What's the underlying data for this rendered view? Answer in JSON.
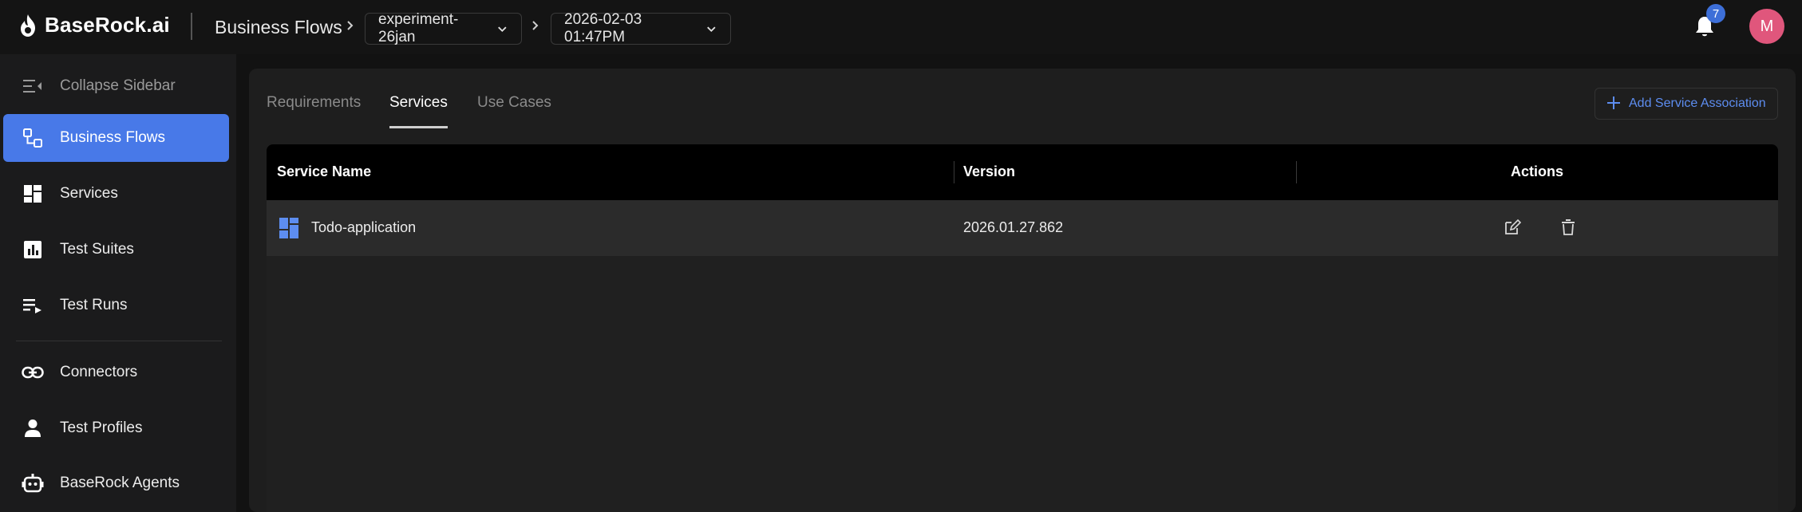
{
  "app": {
    "name": "BaseRock.ai"
  },
  "header": {
    "title": "Business Flows",
    "project_select": "experiment-26jan",
    "run_select": "2026-02-03 01:47PM",
    "notification_count": "7",
    "avatar_initial": "M"
  },
  "sidebar": {
    "collapse_label": "Collapse Sidebar",
    "items": [
      {
        "label": "Business Flows",
        "icon": "business-flows-icon",
        "active": true
      },
      {
        "label": "Services",
        "icon": "services-icon"
      },
      {
        "label": "Test Suites",
        "icon": "test-suites-icon"
      },
      {
        "label": "Test Runs",
        "icon": "test-runs-icon"
      },
      {
        "label": "Connectors",
        "icon": "link-icon"
      },
      {
        "label": "Test Profiles",
        "icon": "person-icon"
      },
      {
        "label": "BaseRock Agents",
        "icon": "robot-icon"
      }
    ]
  },
  "tabs": [
    {
      "label": "Requirements"
    },
    {
      "label": "Services",
      "active": true
    },
    {
      "label": "Use Cases"
    }
  ],
  "actions": {
    "add_label": "Add Service Association"
  },
  "table": {
    "columns": [
      "Service Name",
      "Version",
      "Actions"
    ],
    "rows": [
      {
        "service_name": "Todo-application",
        "version": "2026.01.27.862"
      }
    ]
  },
  "colors": {
    "accent": "#4879e8",
    "link": "#5d8df0",
    "avatar": "#e0567c",
    "badge": "#3d6fd8"
  }
}
